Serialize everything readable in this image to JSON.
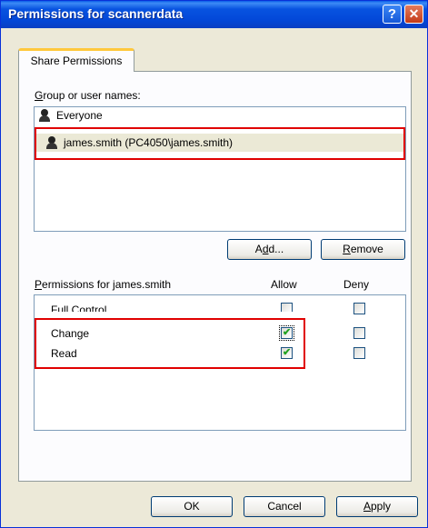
{
  "window": {
    "title": "Permissions for scannerdata",
    "help_button": "?",
    "close_button": "✕"
  },
  "tabs": [
    {
      "label": "Share Permissions"
    }
  ],
  "groups": {
    "label_first": "G",
    "label_rest": "roup or user names:",
    "items": [
      {
        "name": "Everyone",
        "icon": "group-users-icon"
      },
      {
        "name": "james.smith (PC4050\\james.smith)",
        "icon": "user-icon",
        "selected": true
      }
    ],
    "add_button_pre": "A",
    "add_button_u": "d",
    "add_button_post": "d...",
    "remove_button_u": "R",
    "remove_button_rest": "emove"
  },
  "permissions": {
    "label_first": "P",
    "label_rest": "ermissions for james.smith",
    "allow_header": "Allow",
    "deny_header": "Deny",
    "rows": [
      {
        "name": "Full Control",
        "allow": false,
        "deny": false
      },
      {
        "name": "Change",
        "allow": true,
        "deny": false
      },
      {
        "name": "Read",
        "allow": true,
        "deny": false
      }
    ]
  },
  "footer": {
    "ok": "OK",
    "cancel": "Cancel",
    "apply_u": "A",
    "apply_rest": "pply"
  },
  "colors": {
    "highlight": "#e00000",
    "title_bar": "#0348d8"
  }
}
